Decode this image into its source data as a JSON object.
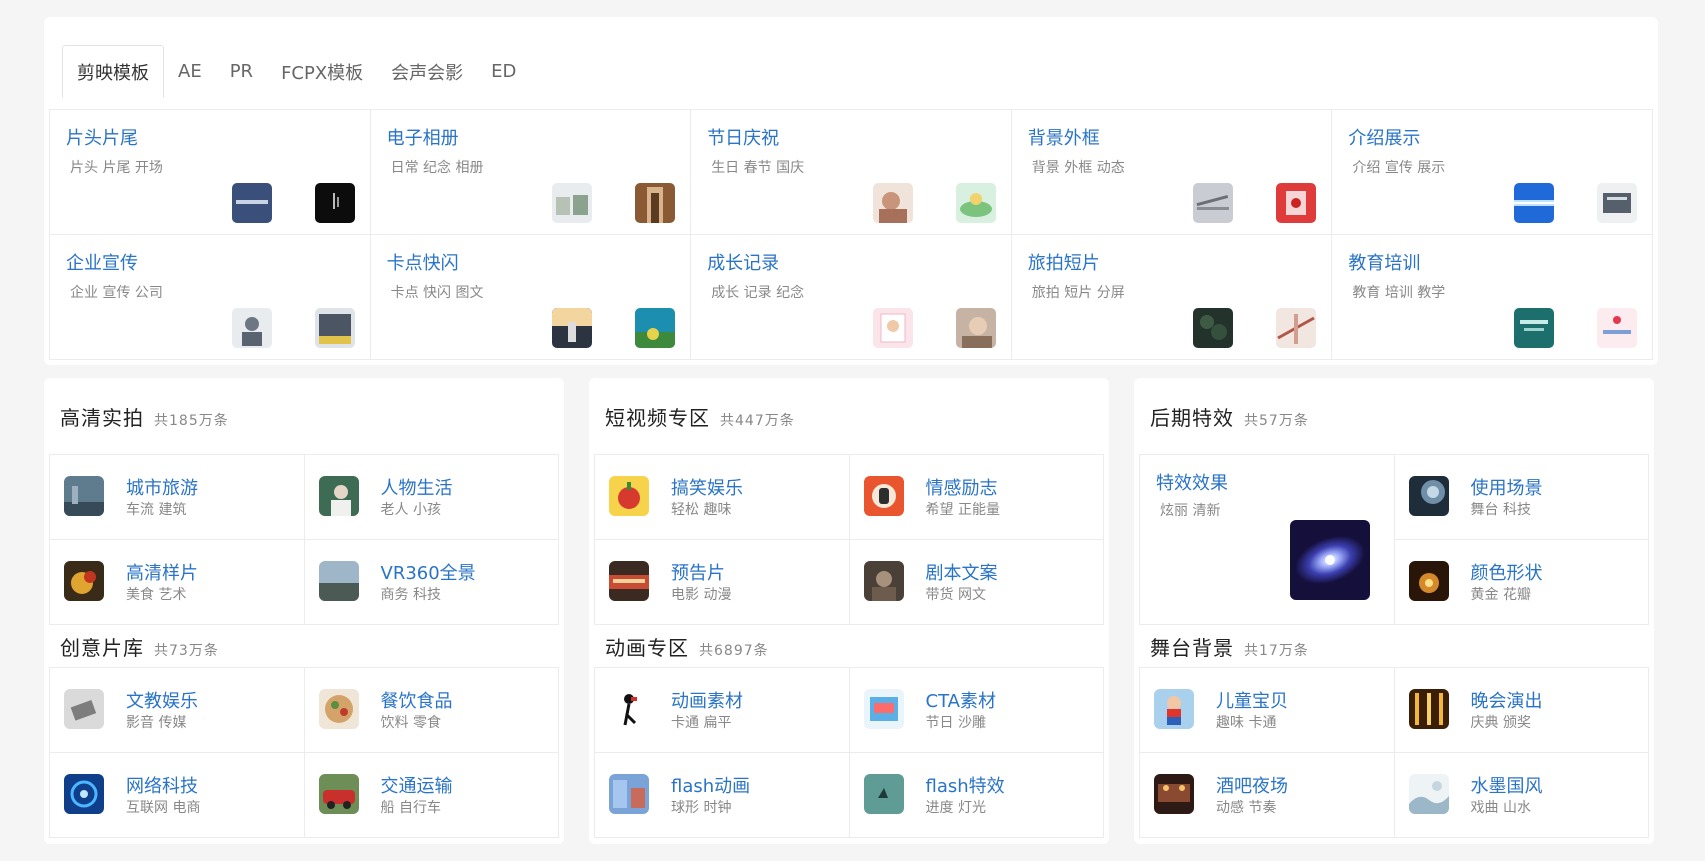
{
  "tabs": [
    "剪映模板",
    "AE",
    "PR",
    "FCPX模板",
    "会声会影",
    "ED"
  ],
  "categories": [
    {
      "title": "片头片尾",
      "tags": "片头 片尾 开场"
    },
    {
      "title": "电子相册",
      "tags": "日常 纪念 相册"
    },
    {
      "title": "节日庆祝",
      "tags": "生日 春节 国庆"
    },
    {
      "title": "背景外框",
      "tags": "背景 外框 动态"
    },
    {
      "title": "介绍展示",
      "tags": "介绍 宣传 展示"
    },
    {
      "title": "企业宣传",
      "tags": "企业 宣传 公司"
    },
    {
      "title": "卡点快闪",
      "tags": "卡点 快闪 图文"
    },
    {
      "title": "成长记录",
      "tags": "成长 记录 纪念"
    },
    {
      "title": "旅拍短片",
      "tags": "旅拍 短片 分屏"
    },
    {
      "title": "教育培训",
      "tags": "教育 培训 教学"
    }
  ],
  "sections": {
    "hd": {
      "title": "高清实拍",
      "count": "共185万条",
      "items": [
        {
          "title": "城市旅游",
          "tags": "车流 建筑"
        },
        {
          "title": "人物生活",
          "tags": "老人 小孩"
        },
        {
          "title": "高清样片",
          "tags": "美食 艺术"
        },
        {
          "title": "VR360全景",
          "tags": "商务 科技"
        }
      ]
    },
    "creative": {
      "title": "创意片库",
      "count": "共73万条",
      "items": [
        {
          "title": "文教娱乐",
          "tags": "影音 传媒"
        },
        {
          "title": "餐饮食品",
          "tags": "饮料 零食"
        },
        {
          "title": "网络科技",
          "tags": "互联网 电商"
        },
        {
          "title": "交通运输",
          "tags": "船 自行车"
        }
      ]
    },
    "short": {
      "title": "短视频专区",
      "count": "共447万条",
      "items": [
        {
          "title": "搞笑娱乐",
          "tags": "轻松 趣味"
        },
        {
          "title": "情感励志",
          "tags": "希望 正能量"
        },
        {
          "title": "预告片",
          "tags": "电影 动漫"
        },
        {
          "title": "剧本文案",
          "tags": "带货 网文"
        }
      ]
    },
    "anim": {
      "title": "动画专区",
      "count": "共6897条",
      "items": [
        {
          "title": "动画素材",
          "tags": "卡通 扁平"
        },
        {
          "title": "CTA素材",
          "tags": "节日 沙雕"
        },
        {
          "title": "flash动画",
          "tags": "球形 时钟"
        },
        {
          "title": "flash特效",
          "tags": "进度 灯光"
        }
      ]
    },
    "fx": {
      "title": "后期特效",
      "count": "共57万条",
      "big": {
        "title": "特效效果",
        "tags": "炫丽 清新"
      },
      "items": [
        {
          "title": "使用场景",
          "tags": "舞台 科技"
        },
        {
          "title": "颜色形状",
          "tags": "黄金 花瓣"
        }
      ]
    },
    "stage": {
      "title": "舞台背景",
      "count": "共17万条",
      "items": [
        {
          "title": "儿童宝贝",
          "tags": "趣味 卡通"
        },
        {
          "title": "晚会演出",
          "tags": "庆典 颁奖"
        },
        {
          "title": "酒吧夜场",
          "tags": "动感 节奏"
        },
        {
          "title": "水墨国风",
          "tags": "戏曲 山水"
        }
      ]
    }
  }
}
